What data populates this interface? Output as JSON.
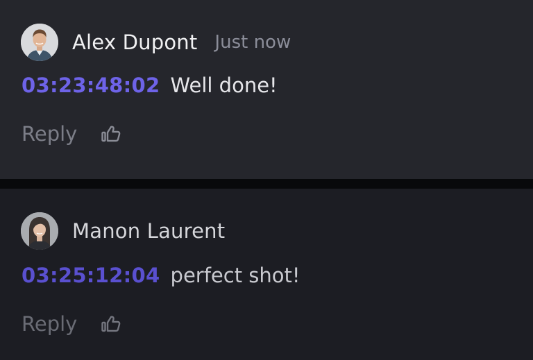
{
  "comments": [
    {
      "author": "Alex Dupont",
      "time": "Just now",
      "timestamp": "03:23:48:02",
      "text": "Well done!",
      "reply_label": "Reply",
      "avatar_icon": "male-avatar"
    },
    {
      "author": "Manon Laurent",
      "time": "",
      "timestamp": "03:25:12:04",
      "text": "perfect shot!",
      "reply_label": "Reply",
      "avatar_icon": "female-avatar"
    }
  ],
  "icons": {
    "like": "thumbs-up-icon"
  },
  "colors": {
    "timestamp": "#6e63e8",
    "card_active": "#25262c",
    "card": "#1c1d23",
    "muted": "#7c7e88"
  }
}
